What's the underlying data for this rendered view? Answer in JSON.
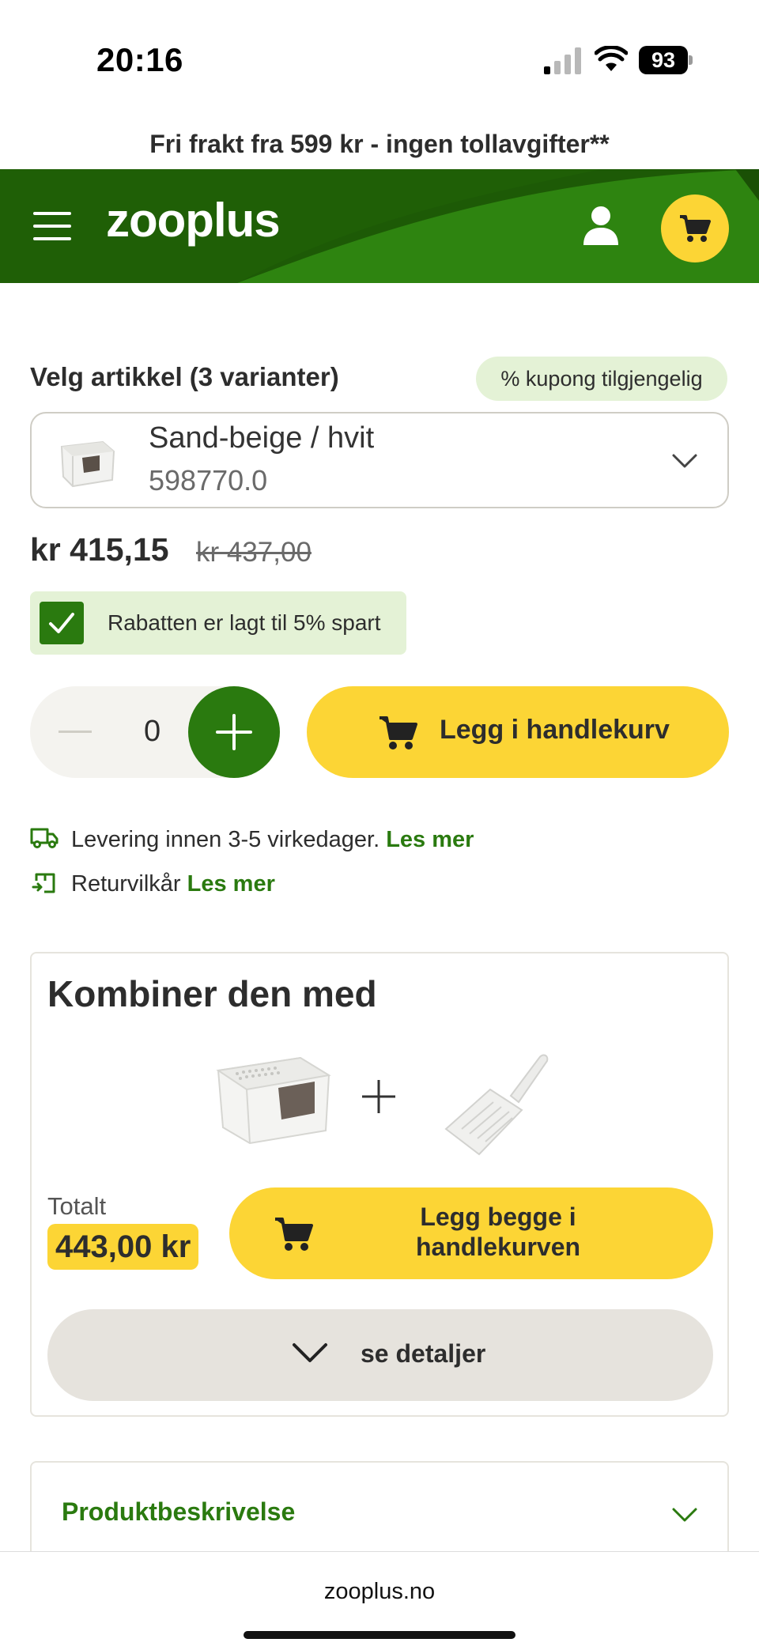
{
  "status_bar": {
    "time": "20:16",
    "battery": "93"
  },
  "promo_banner": "Fri frakt fra 599 kr - ingen tollavgifter**",
  "header": {
    "logo": "zooplus"
  },
  "variant": {
    "label": "Velg artikkel (3 varianter)",
    "coupon_badge": "% kupong tilgjengelig",
    "selected_name": "Sand-beige / hvit",
    "selected_number": "598770.0"
  },
  "price": {
    "current": "kr 415,15",
    "original": "kr 437,00"
  },
  "discount": {
    "text": "Rabatten er lagt til 5% spart"
  },
  "quantity": {
    "value": "0"
  },
  "add_to_cart_label": "Legg i handlekurv",
  "delivery": {
    "text": "Levering innen 3-5 virkedager.",
    "link": "Les mer"
  },
  "returns": {
    "text": "Returvilkår",
    "link": "Les mer"
  },
  "combine": {
    "title": "Kombiner den med",
    "total_label": "Totalt",
    "total_value": "443,00 kr",
    "add_both_line1": "Legg begge i",
    "add_both_line2": "handlekurven",
    "details_label": "se detaljer"
  },
  "description": {
    "title": "Produktbeskrivelse"
  },
  "browser": {
    "url": "zooplus.no"
  },
  "colors": {
    "brand_green": "#2a7a0f",
    "brand_yellow": "#fcd535",
    "light_green": "#e4f2d6"
  }
}
